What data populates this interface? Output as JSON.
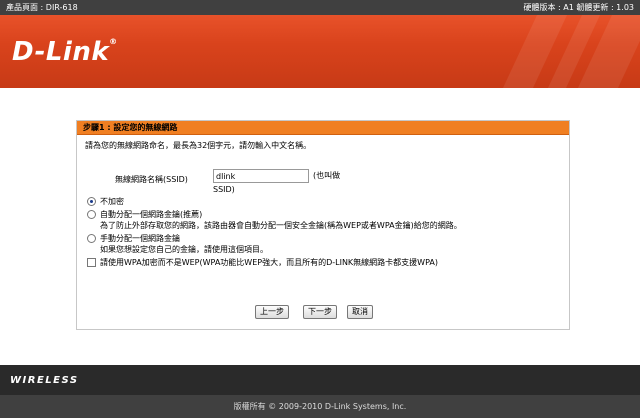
{
  "topbar": {
    "product_page": "產品頁面 : DIR-618",
    "version": "硬體版本 : A1  韌體更新 : 1.03"
  },
  "banner": {
    "logo": "D-Link",
    "logo_mark": "®"
  },
  "panel": {
    "title": "步驟1 : 設定您的無線網路",
    "intro": "請為您的無線網路命名，最長為32個字元，請勿輸入中文名稱。",
    "ssid_label": "無線網路名稱(SSID)",
    "ssid_value": "dlink",
    "ssid_hint_1": "(也叫做",
    "ssid_hint_2": "SSID)",
    "options": [
      {
        "label": "不加密",
        "selected": true
      },
      {
        "label": "自動分配一個網路金鑰(推薦)",
        "selected": false,
        "desc": "為了防止外部存取您的網路，該路由器會自動分配一個安全金鑰(稱為WEP或者WPA金鑰)給您的網路。"
      },
      {
        "label": "手動分配一個網路金鑰",
        "selected": false,
        "desc": "如果您想設定您自己的金鑰，請使用這個項目。"
      }
    ],
    "wpa_checkbox": "請使用WPA加密而不是WEP(WPA功能比WEP強大，而且所有的D-LINK無線網路卡都支援WPA)",
    "buttons": {
      "prev": "上一步",
      "next": "下一步",
      "cancel": "取消"
    }
  },
  "wireless_bar": "WIRELESS",
  "footer": "版權所有 © 2009-2010 D-Link Systems, Inc.",
  "colors": {
    "accent_orange": "#f07f22",
    "banner_orange": "#d9431c",
    "dark_bar": "#404040"
  }
}
